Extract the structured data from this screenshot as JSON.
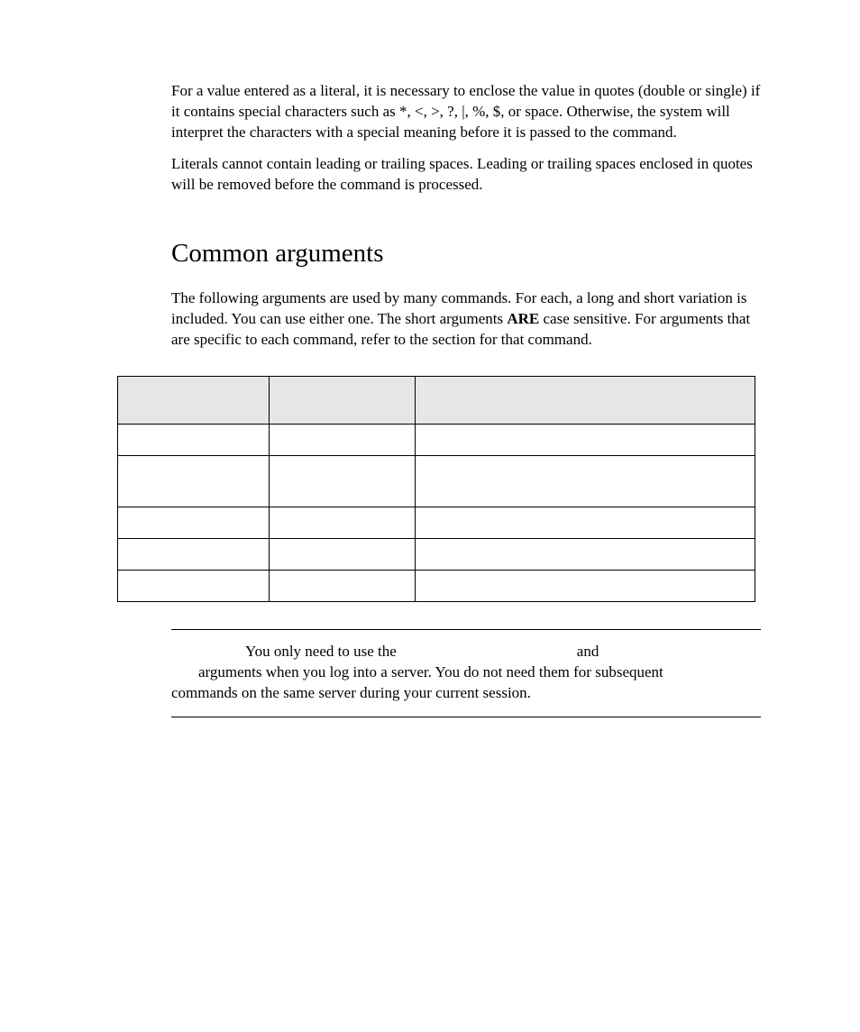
{
  "para1": "For a value entered as a literal, it is necessary to enclose the value in quotes (double or single) if it contains special characters such as *, <, >, ?, |, %, $, or space. Otherwise, the system will interpret the characters with a special meaning before it is passed to the command.",
  "para2": "Literals cannot contain leading or trailing spaces. Leading or trailing spaces enclosed in quotes will be removed before the command is processed.",
  "heading": "Common arguments",
  "para3_a": "The following arguments are used by many commands. For each, a long and short variation is included. You can use either one. The short arguments ",
  "para3_b": "ARE",
  "para3_c": " case sensitive. For arguments that are specific to each command, refer to the section for that command.",
  "note_l1_a": "You only need to use the",
  "note_l1_b": "and",
  "note_l2": "arguments when you log into a server.  You do not need them for subsequent",
  "note_l3": "commands on the same server during your current session.",
  "table_headers": [
    "",
    "",
    ""
  ],
  "table_rows": [
    [
      "",
      "",
      ""
    ],
    [
      "",
      "",
      ""
    ],
    [
      "",
      "",
      ""
    ],
    [
      "",
      "",
      ""
    ],
    [
      "",
      "",
      ""
    ]
  ]
}
